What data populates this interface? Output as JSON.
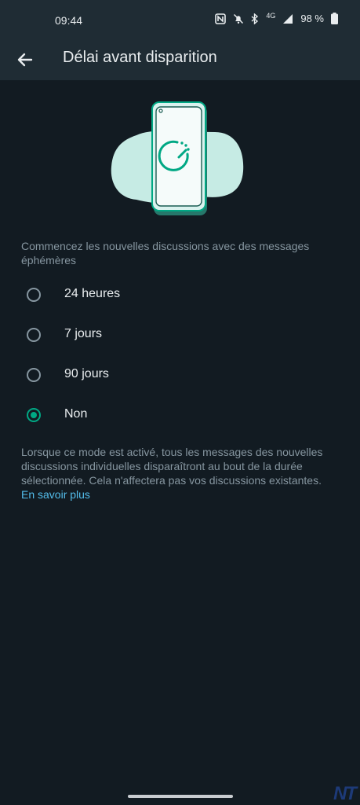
{
  "status_bar": {
    "time": "09:44",
    "battery": "98 %",
    "network": "4G"
  },
  "app_bar": {
    "title": "Délai avant disparition"
  },
  "intro_text": "Commencez les nouvelles discussions avec des messages éphémères",
  "options": [
    {
      "label": "24 heures",
      "selected": false
    },
    {
      "label": "7 jours",
      "selected": false
    },
    {
      "label": "90 jours",
      "selected": false
    },
    {
      "label": "Non",
      "selected": true
    }
  ],
  "footer": {
    "text": "Lorsque ce mode est activé, tous les messages des nouvelles discussions individuelles disparaîtront au bout de la durée sélectionnée. Cela n'affectera pas vos discussions existantes.",
    "link": "En savoir plus"
  },
  "watermark": "NT",
  "colors": {
    "background": "#121b22",
    "bar": "#1f2c34",
    "accent": "#00a884",
    "link": "#53bdeb",
    "secondary_text": "#8696a0"
  }
}
